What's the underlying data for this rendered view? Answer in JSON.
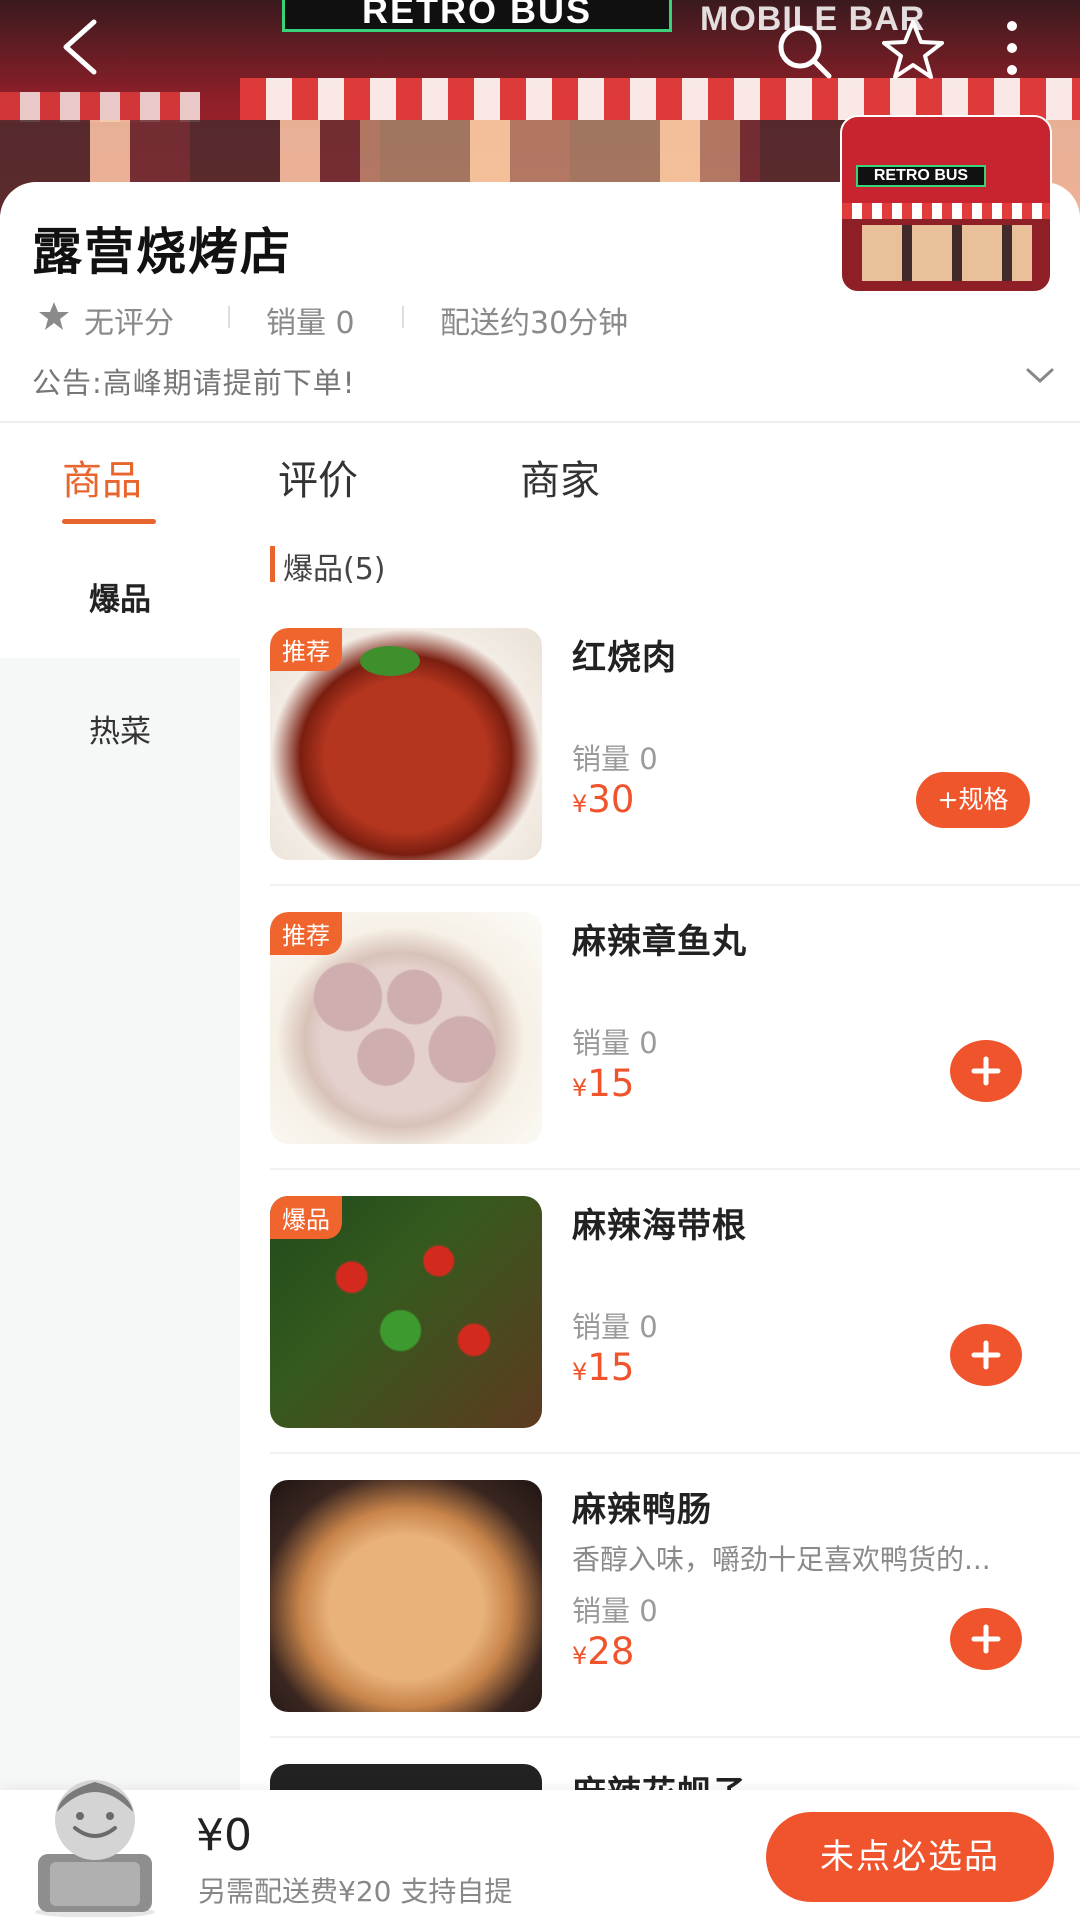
{
  "hero": {
    "sign_left": "RETRO BUS",
    "sign_right": "MOBILE BAR"
  },
  "shop": {
    "thumb_sign": "RETRO BUS",
    "name": "露营烧烤店",
    "rating": "无评分",
    "sales": "销量 0",
    "delivery": "配送约30分钟",
    "notice": "公告:高峰期请提前下单!"
  },
  "tabs": [
    {
      "label": "商品",
      "active": true
    },
    {
      "label": "评价",
      "active": false
    },
    {
      "label": "商家",
      "active": false
    }
  ],
  "sidebar": {
    "items": [
      {
        "label": "爆品",
        "selected": true
      },
      {
        "label": "热菜",
        "selected": false
      }
    ]
  },
  "section": {
    "title": "爆品(5)"
  },
  "products": [
    {
      "badge": "推荐",
      "name": "红烧肉",
      "desc": "",
      "sales": "销量 0",
      "currency": "¥",
      "price": "30",
      "action": "+规格",
      "image": "red-braised-pork"
    },
    {
      "badge": "推荐",
      "name": "麻辣章鱼丸",
      "desc": "",
      "sales": "销量 0",
      "currency": "¥",
      "price": "15",
      "action": "+",
      "image": "octopus-balls"
    },
    {
      "badge": "爆品",
      "name": "麻辣海带根",
      "desc": "",
      "sales": "销量 0",
      "currency": "¥",
      "price": "15",
      "action": "+",
      "image": "spicy-kelp"
    },
    {
      "badge": "",
      "name": "麻辣鸭肠",
      "desc": "香醇入味，嚼劲十足喜欢鸭货的...",
      "sales": "销量 0",
      "currency": "¥",
      "price": "28",
      "action": "+",
      "image": "duck-intestine"
    },
    {
      "badge": "",
      "name": "麻辣花蚬子",
      "desc": "",
      "sales": "",
      "currency": "",
      "price": "",
      "action": "",
      "image": "spicy-clams"
    }
  ],
  "cart": {
    "total": "¥0",
    "note": "另需配送费¥20  支持自提",
    "checkout_label": "未点必选品"
  },
  "colors": {
    "accent": "#f0542d",
    "tab_active": "#e8662e"
  }
}
